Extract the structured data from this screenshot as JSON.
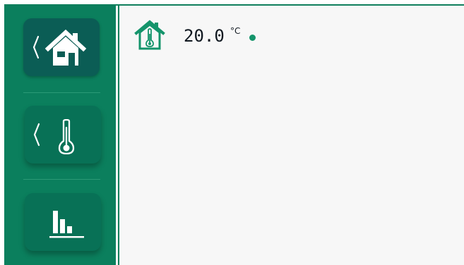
{
  "sidebar": {
    "items": [
      {
        "icon": "home-icon",
        "state": "active"
      },
      {
        "icon": "thermometer-icon",
        "state": "inactive"
      },
      {
        "icon": "bar-chart-icon",
        "state": "inactive"
      }
    ]
  },
  "main": {
    "status": {
      "icon": "home-temperature-icon",
      "temperature": "20.0",
      "unit": "°C",
      "indicator": "status-dot"
    }
  },
  "colors": {
    "sidebar": "#0b7f5d",
    "active_button": "#0b5d55",
    "inactive_button": "#087156",
    "content_background": "#f7f7f7",
    "accent": "#14946b",
    "text": "#101820"
  }
}
